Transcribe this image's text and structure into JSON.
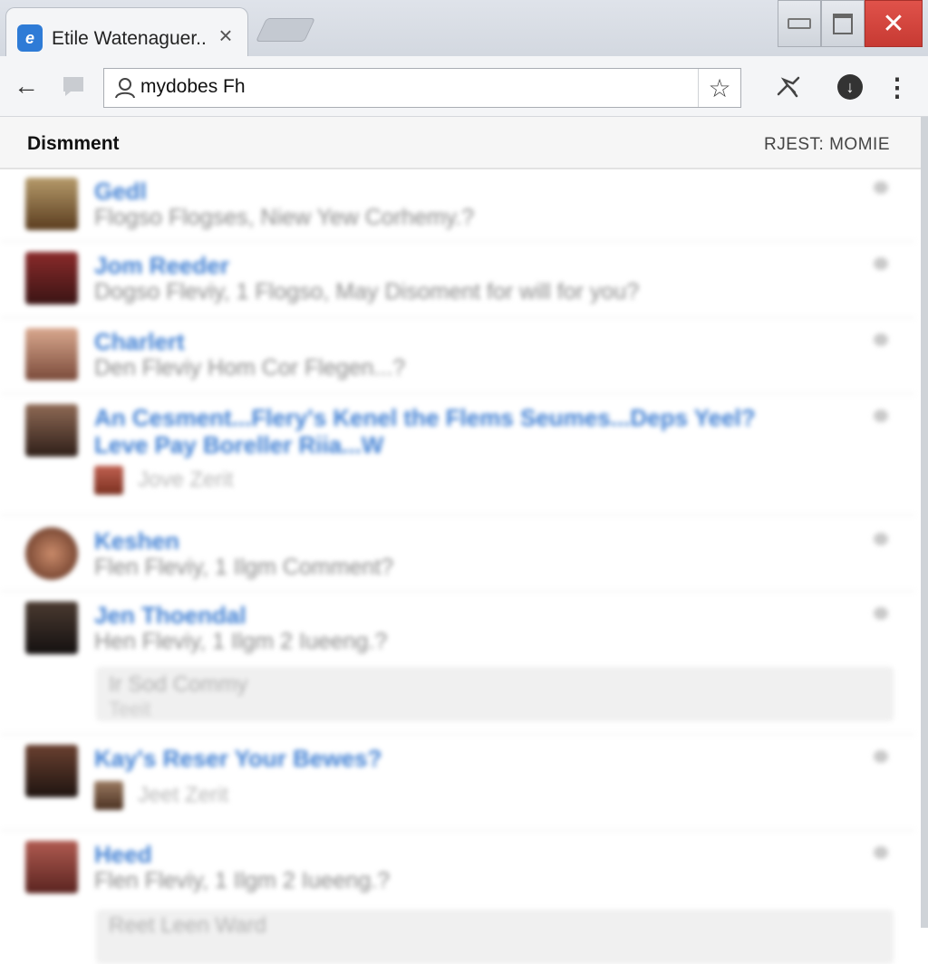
{
  "browser": {
    "tab_title": "Etile Watenaguer..",
    "tab_close": "×",
    "address": "mydobes Fh",
    "back_glyph": "←",
    "star_glyph": "☆",
    "menu_glyph": "⋮",
    "close_glyph": "✕"
  },
  "page": {
    "title": "Dismment",
    "meta": "RJEST: MOMIE"
  },
  "comments": [
    {
      "name": "Gedl",
      "text": "Flogso Flogses, Niew Yew Corhemy.?"
    },
    {
      "name": "Jom Reeder",
      "text": "Dogso Fleviy, 1 Flogso, May Disoment for will for you?"
    },
    {
      "name": "Charlert",
      "text": "Den Fleviy Hom Cor Flegen...?"
    },
    {
      "name": "An Cesment...Flery's Kenel the Flems Seumes...Deps Yeel?",
      "name2": "Leve Pay Boreller Riia...W",
      "sub": "Jove Zerit"
    },
    {
      "name": "Keshen",
      "text": "Flen Fleviy, 1 Ilgm Comment?"
    },
    {
      "name": "Jen Thoendal",
      "text": "Hen Fleviy, 1 Ilgm 2 Iueeng.?",
      "quote1": "Ir Sod Commy",
      "quote2": "Teeit"
    },
    {
      "name": "Kay's Reser Your Bewes?",
      "sub": "Jeet Zerit"
    },
    {
      "name": "Heed",
      "text": "Flen Fleviy, 1 Ilgm 2 Iueeng.?",
      "quote1": "Reet Leen Ward"
    }
  ],
  "colors": {
    "link": "#3f7fd3",
    "close_button": "#d9463f",
    "favicon": "#2e7bd6"
  }
}
